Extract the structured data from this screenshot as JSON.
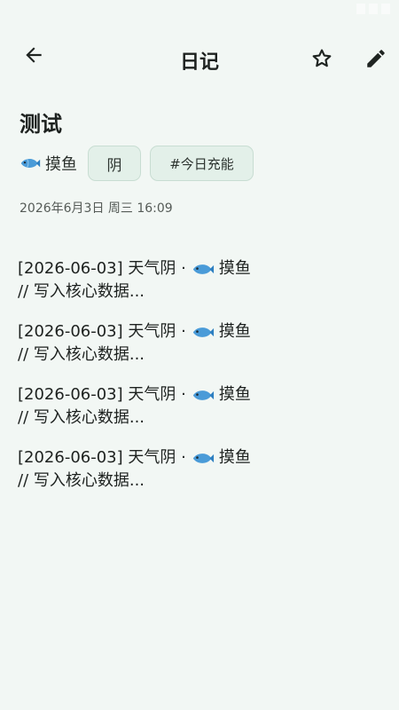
{
  "header": {
    "title": "日记",
    "back_icon": "arrow-left-icon",
    "star_icon": "star-outline-icon",
    "edit_icon": "pencil-icon"
  },
  "entry": {
    "title": "测试",
    "mood_icon": "fish-emoji-icon",
    "mood_label": "摸鱼",
    "weather_chip": "阴",
    "topic_chip": "#今日充能",
    "timestamp": "2026年6月3日 周三 16:09"
  },
  "log": [
    {
      "prefix": "[2026-06-03] 天气阴 ·",
      "mood": "摸鱼",
      "content": "// 写入核心数据..."
    },
    {
      "prefix": "[2026-06-03] 天气阴 ·",
      "mood": "摸鱼",
      "content": "// 写入核心数据..."
    },
    {
      "prefix": "[2026-06-03] 天气阴 ·",
      "mood": "摸鱼",
      "content": "// 写入核心数据..."
    },
    {
      "prefix": "[2026-06-03] 天气阴 ·",
      "mood": "摸鱼",
      "content": "// 写入核心数据..."
    }
  ],
  "colors": {
    "background": "#f2f7f4",
    "chip_background": "#e3f0e9",
    "chip_border": "#c8ddd2",
    "text": "#1d211f"
  }
}
